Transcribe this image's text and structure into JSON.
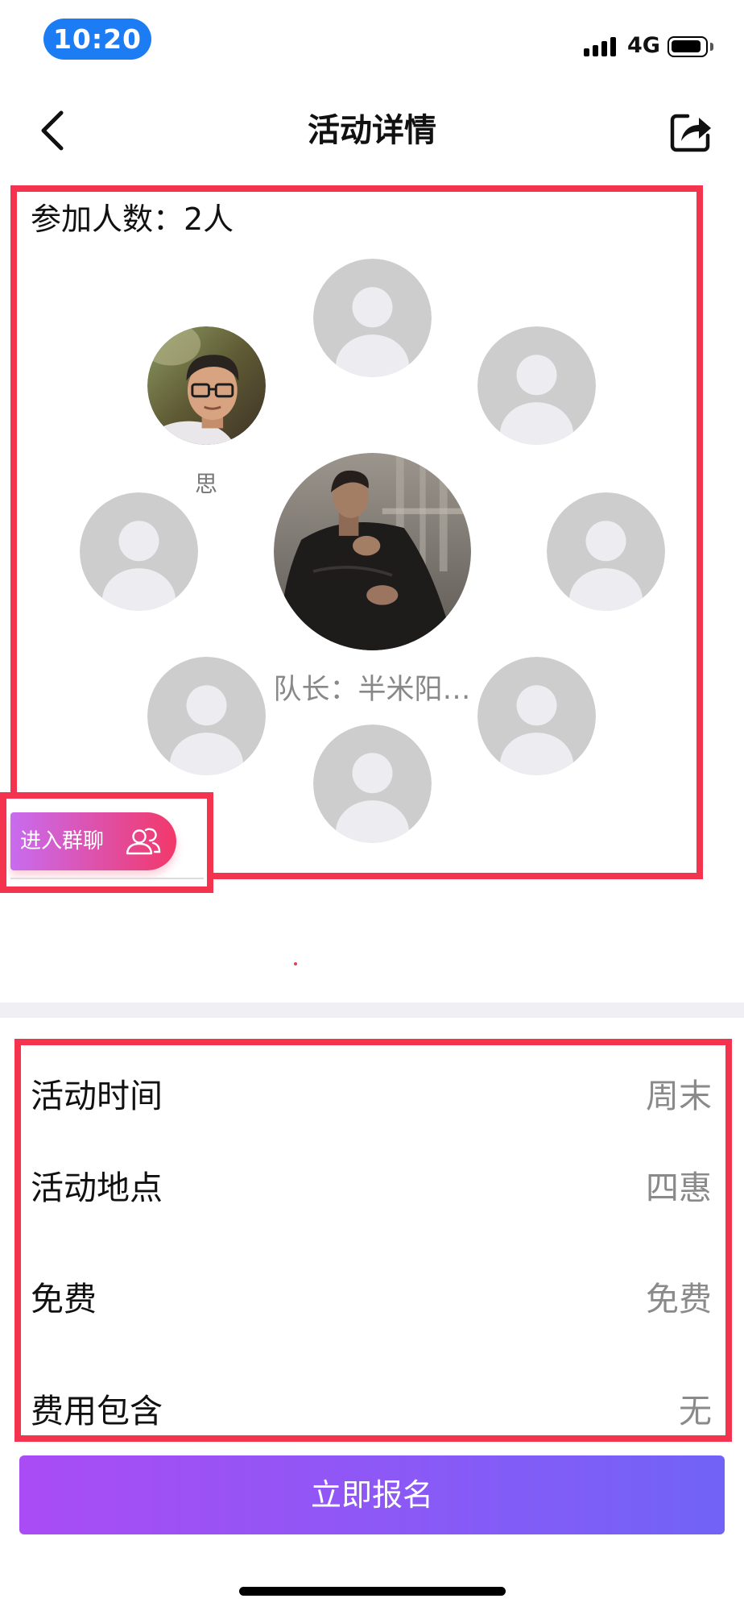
{
  "status_bar": {
    "time": "10:20",
    "network": "4G",
    "icons": {
      "signal": "cellular-signal-icon",
      "battery": "battery-icon"
    }
  },
  "nav": {
    "title": "活动详情",
    "back_icon": "chevron-left-icon",
    "share_icon": "share-icon"
  },
  "participants": {
    "count_label": "参加人数：2人",
    "member_name": "思",
    "leader_label": "队长：半米阳…",
    "placeholder_icon": "default-user-avatar-icon"
  },
  "group_chat": {
    "label": "进入群聊",
    "icon": "group-users-icon"
  },
  "details": [
    {
      "label": "活动时间",
      "value": "周末"
    },
    {
      "label": "活动地点",
      "value": "四惠"
    },
    {
      "label": "免费",
      "value": "免费"
    },
    {
      "label": "费用包含",
      "value": "无"
    }
  ],
  "signup": {
    "label": "立即报名"
  },
  "colors": {
    "annotation_red": "#f4344f",
    "status_pill": "#1b7cf4",
    "button_gradient_start": "#aa4cf5",
    "button_gradient_end": "#7163f6",
    "chat_gradient_start": "#c86cf0",
    "chat_gradient_end": "#f2386a",
    "placeholder_avatar": "#cdcdcd"
  }
}
